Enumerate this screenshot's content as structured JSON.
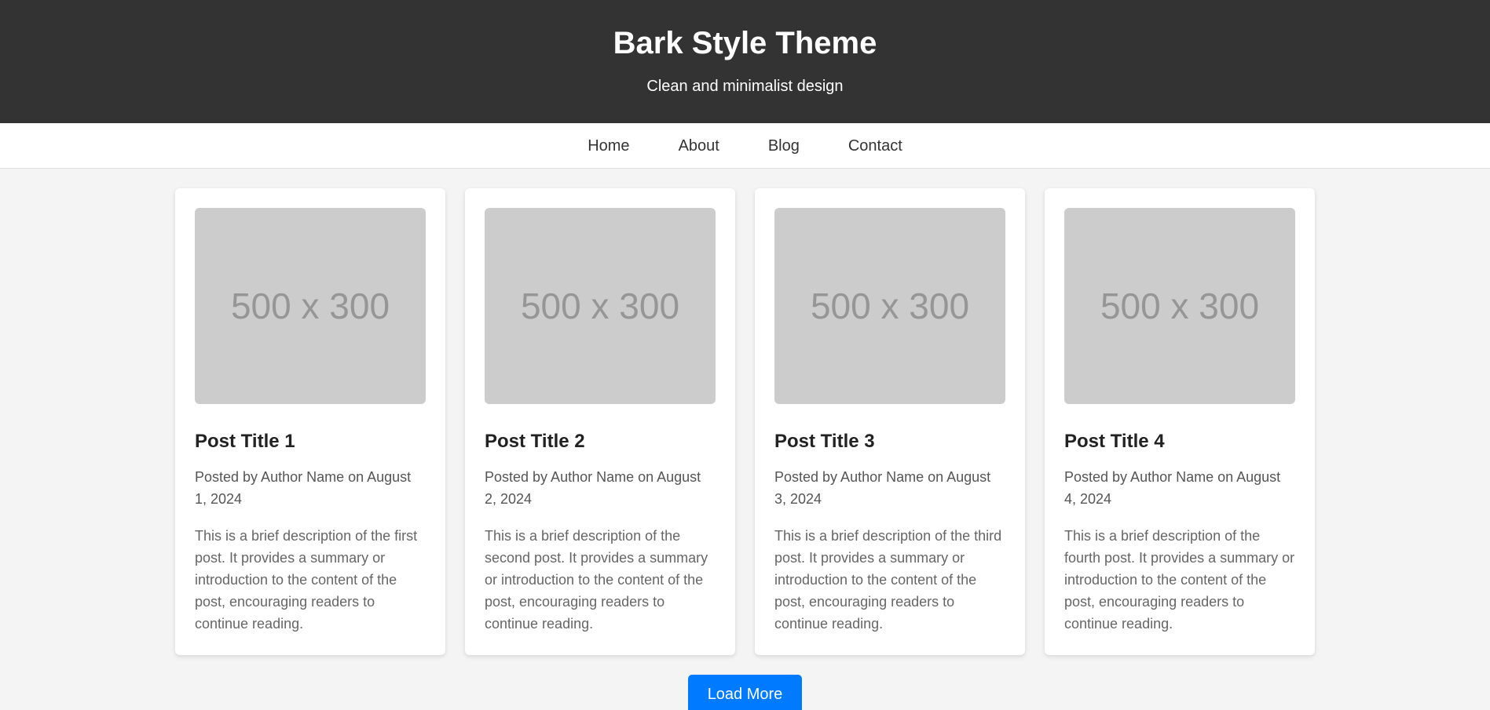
{
  "header": {
    "title": "Bark Style Theme",
    "tagline": "Clean and minimalist design"
  },
  "nav": {
    "items": [
      {
        "label": "Home"
      },
      {
        "label": "About"
      },
      {
        "label": "Blog"
      },
      {
        "label": "Contact"
      }
    ]
  },
  "posts": [
    {
      "image_placeholder": "500 x 300",
      "title": "Post Title 1",
      "meta": "Posted by Author Name on August 1, 2024",
      "excerpt": "This is a brief description of the first post. It provides a summary or introduction to the content of the post, encouraging readers to continue reading."
    },
    {
      "image_placeholder": "500 x 300",
      "title": "Post Title 2",
      "meta": "Posted by Author Name on August 2, 2024",
      "excerpt": "This is a brief description of the second post. It provides a summary or introduction to the content of the post, encouraging readers to continue reading."
    },
    {
      "image_placeholder": "500 x 300",
      "title": "Post Title 3",
      "meta": "Posted by Author Name on August 3, 2024",
      "excerpt": "This is a brief description of the third post. It provides a summary or introduction to the content of the post, encouraging readers to continue reading."
    },
    {
      "image_placeholder": "500 x 300",
      "title": "Post Title 4",
      "meta": "Posted by Author Name on August 4, 2024",
      "excerpt": "This is a brief description of the fourth post. It provides a summary or introduction to the content of the post, encouraging readers to continue reading."
    }
  ],
  "load_more": {
    "label": "Load More"
  },
  "colors": {
    "header_bg": "#333333",
    "page_bg": "#f4f4f4",
    "accent": "#007bff",
    "image_placeholder_bg": "#cccccc"
  }
}
